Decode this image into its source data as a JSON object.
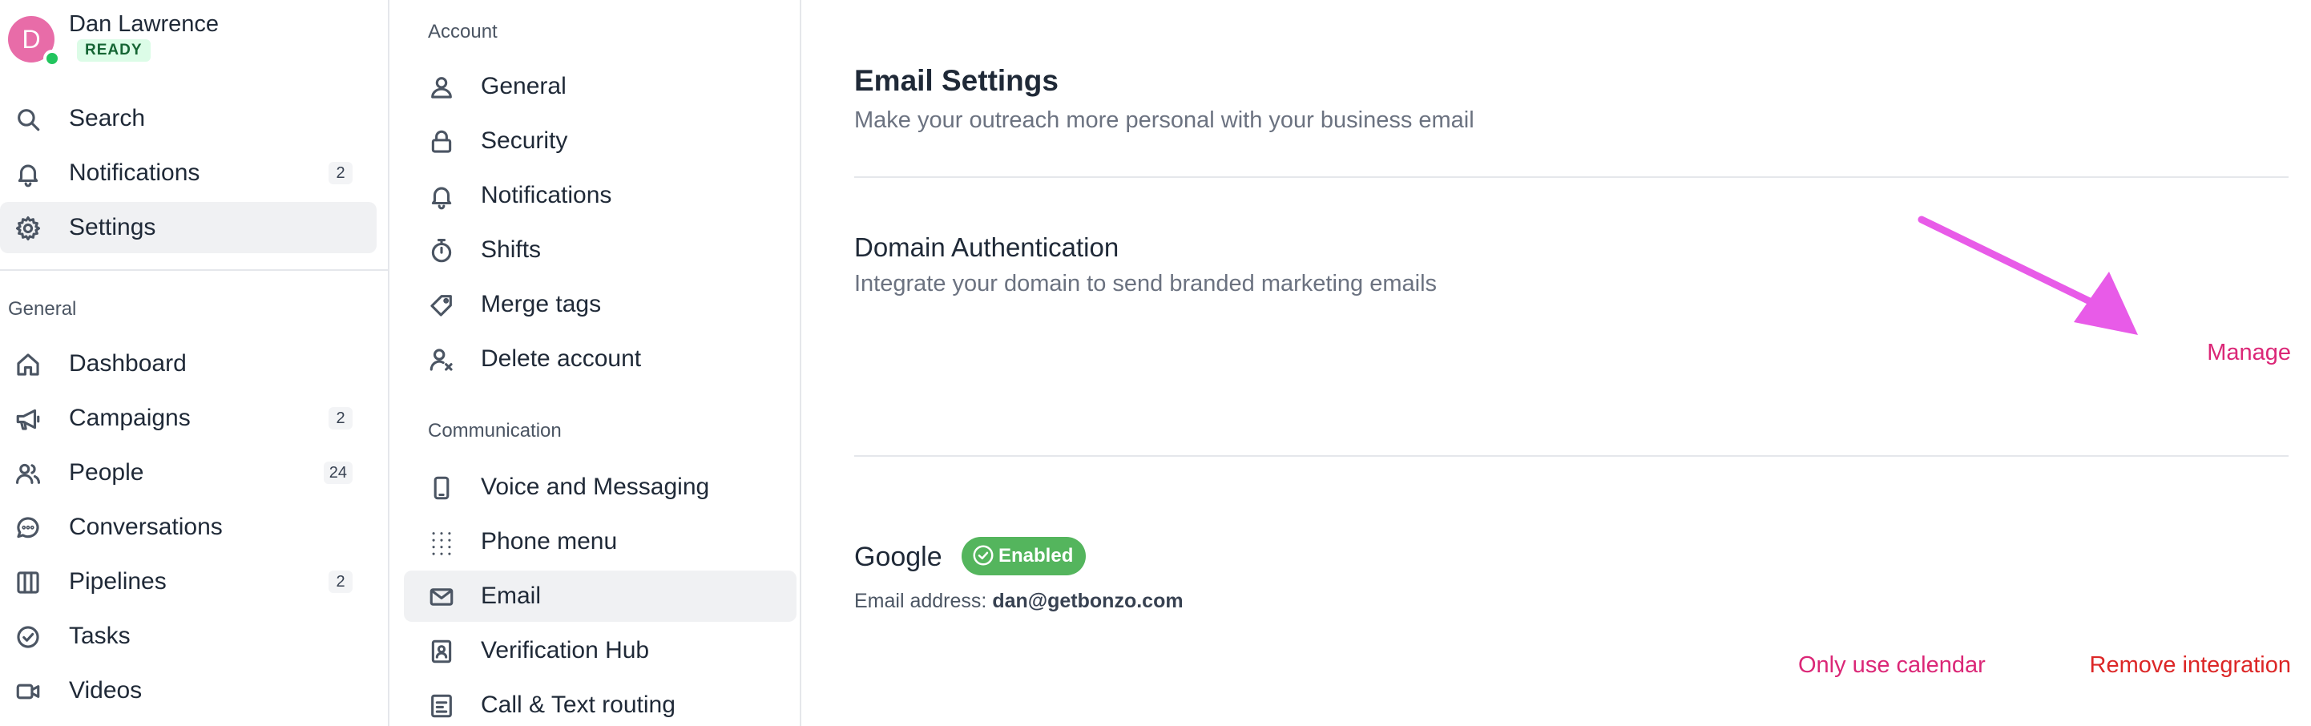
{
  "user": {
    "initial": "D",
    "name": "Dan Lawrence",
    "status": "READY"
  },
  "sidebar": {
    "top_items": [
      {
        "label": "Search",
        "icon": "search-icon"
      },
      {
        "label": "Notifications",
        "icon": "bell-icon",
        "count": "2"
      },
      {
        "label": "Settings",
        "icon": "gear-icon",
        "active": true
      }
    ],
    "section_label": "General",
    "items": [
      {
        "label": "Dashboard",
        "icon": "home-icon"
      },
      {
        "label": "Campaigns",
        "icon": "megaphone-icon",
        "count": "2"
      },
      {
        "label": "People",
        "icon": "people-icon",
        "count": "24"
      },
      {
        "label": "Conversations",
        "icon": "chat-icon"
      },
      {
        "label": "Pipelines",
        "icon": "columns-icon",
        "count": "2"
      },
      {
        "label": "Tasks",
        "icon": "check-circle-icon"
      },
      {
        "label": "Videos",
        "icon": "video-icon"
      }
    ]
  },
  "settings_nav": {
    "account_label": "Account",
    "account_items": [
      {
        "label": "General",
        "icon": "user-icon"
      },
      {
        "label": "Security",
        "icon": "lock-icon"
      },
      {
        "label": "Notifications",
        "icon": "bell-icon"
      },
      {
        "label": "Shifts",
        "icon": "stopwatch-icon"
      },
      {
        "label": "Merge tags",
        "icon": "tag-icon"
      },
      {
        "label": "Delete account",
        "icon": "user-remove-icon"
      }
    ],
    "communication_label": "Communication",
    "communication_items": [
      {
        "label": "Voice and Messaging",
        "icon": "phone-device-icon"
      },
      {
        "label": "Phone menu",
        "icon": "dialpad-icon"
      },
      {
        "label": "Email",
        "icon": "envelope-icon",
        "active": true
      },
      {
        "label": "Verification Hub",
        "icon": "id-badge-icon"
      },
      {
        "label": "Call & Text routing",
        "icon": "routing-icon"
      }
    ]
  },
  "main": {
    "title": "Email Settings",
    "subtitle": "Make your outreach more personal with your business email",
    "domain": {
      "title": "Domain Authentication",
      "subtitle": "Integrate your domain to send branded marketing emails",
      "manage_label": "Manage"
    },
    "google": {
      "title": "Google",
      "badge": "Enabled",
      "email_label": "Email address:",
      "email_value": "dan@getbonzo.com",
      "calendar_label": "Only use calendar",
      "remove_label": "Remove integration"
    }
  },
  "colors": {
    "accent_pink": "#db2777",
    "danger_red": "#dc2626",
    "success_green": "#54b55d",
    "annotation_arrow": "#e85be8"
  }
}
